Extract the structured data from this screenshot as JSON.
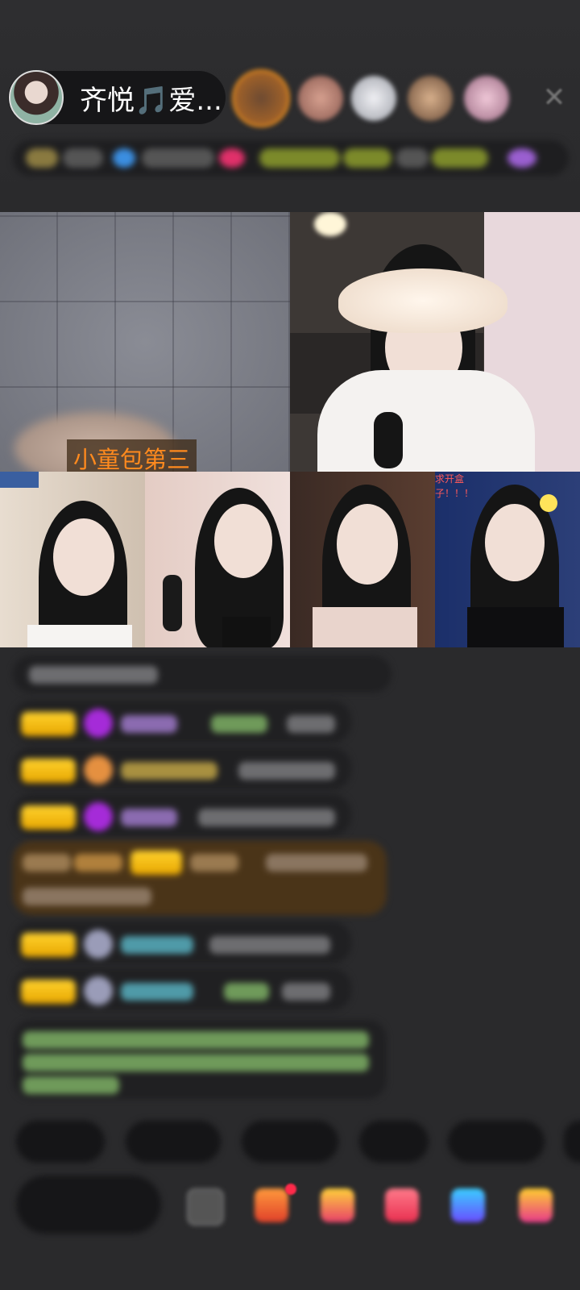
{
  "host": {
    "name": "齐悦🎵爱...",
    "avatar_icon": "host-avatar"
  },
  "viewers": [
    {
      "icon": "viewer-avatar-1",
      "color": "#d9822b"
    },
    {
      "icon": "viewer-avatar-2",
      "color": "#b07a70"
    },
    {
      "icon": "viewer-avatar-3",
      "color": "#c8c8d0"
    },
    {
      "icon": "viewer-avatar-4",
      "color": "#8a6a50"
    },
    {
      "icon": "viewer-avatar-5",
      "color": "#c9a0b0"
    }
  ],
  "close_icon": "close-icon",
  "video_grid": {
    "main_tile_label": "小童包第三",
    "tile_banner": "求开盒子！！！"
  },
  "colors": {
    "background": "#2a2a2c",
    "label_orange": "#ff8a1e",
    "badge_gold": "#ffd22d",
    "highlight_message": "#4a3418"
  }
}
